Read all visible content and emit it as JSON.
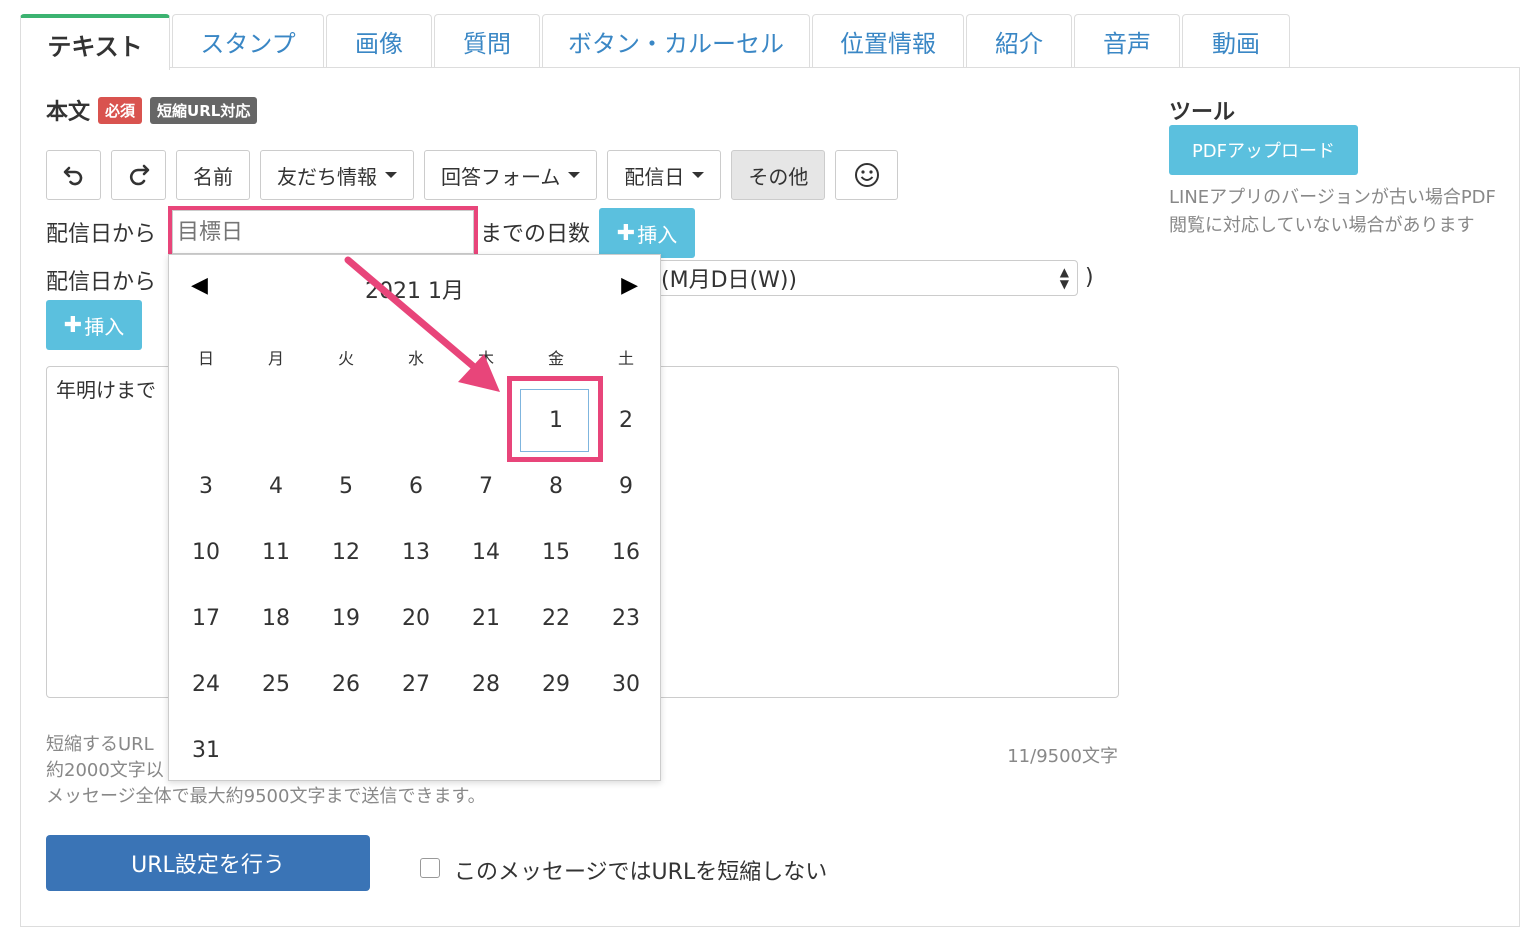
{
  "tabs": [
    "テキスト",
    "スタンプ",
    "画像",
    "質問",
    "ボタン・カルーセル",
    "位置情報",
    "紹介",
    "音声",
    "動画"
  ],
  "body_section": {
    "title": "本文",
    "required_badge": "必須",
    "url_badge": "短縮URL対応"
  },
  "toolbar": {
    "undo_icon": "undo-icon",
    "redo_icon": "redo-icon",
    "name": "名前",
    "friend_info": "友だち情報",
    "answer_form": "回答フォーム",
    "delivery_date": "配信日",
    "other": "その他",
    "emoji_icon": "smiley-icon"
  },
  "row1": {
    "label": "配信日から",
    "placeholder": "目標日",
    "suffix": "までの日数",
    "insert": "挿入"
  },
  "row2": {
    "label": "配信日から",
    "format_value": "(M月D日(W))",
    "close_paren": ")",
    "insert": "挿入"
  },
  "message": {
    "text": "年明けまで"
  },
  "help": {
    "line1": "短縮するURL",
    "line2": "約2000文字以",
    "line3": "メッセージ全体で最大約9500文字まで送信できます。"
  },
  "counter": "11/9500文字",
  "url_button": "URL設定を行う",
  "no_shorten_label": "このメッセージではURLを短縮しない",
  "tools": {
    "title": "ツール",
    "pdf_upload": "PDFアップロード",
    "note": "LINEアプリのバージョンが古い場合PDF閲覧に対応していない場合があります"
  },
  "calendar": {
    "title": "2021 1月",
    "weekdays": [
      "日",
      "月",
      "火",
      "水",
      "木",
      "金",
      "土"
    ],
    "weeks": [
      [
        "",
        "",
        "",
        "",
        "",
        "1",
        "2"
      ],
      [
        "3",
        "4",
        "5",
        "6",
        "7",
        "8",
        "9"
      ],
      [
        "10",
        "11",
        "12",
        "13",
        "14",
        "15",
        "16"
      ],
      [
        "17",
        "18",
        "19",
        "20",
        "21",
        "22",
        "23"
      ],
      [
        "24",
        "25",
        "26",
        "27",
        "28",
        "29",
        "30"
      ],
      [
        "31",
        "",
        "",
        "",
        "",
        "",
        ""
      ]
    ],
    "selected_day": "1"
  },
  "colors": {
    "accent_pink": "#e8457a",
    "info_blue": "#5bc0de",
    "primary_blue": "#3a74b6",
    "required_red": "#d9534f"
  }
}
